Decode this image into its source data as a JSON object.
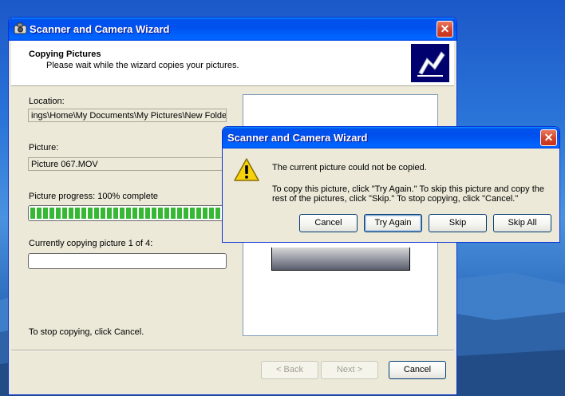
{
  "wizard": {
    "title": "Scanner and Camera Wizard",
    "header_title": "Copying Pictures",
    "header_subtitle": "Please wait while the wizard copies your pictures.",
    "location_label": "Location:",
    "location_value": "ings\\Home\\My Documents\\My Pictures\\New Folder",
    "picture_label": "Picture:",
    "picture_value": "Picture 067.MOV",
    "picture_progress_label": "Picture progress: 100% complete",
    "picture_progress_percent": 100,
    "copying_label": "Currently copying picture 1 of 4:",
    "copying_progress_percent": 0,
    "stop_hint": "To stop copying, click Cancel.",
    "back_label": "< Back",
    "next_label": "Next >",
    "cancel_label": "Cancel"
  },
  "error_dialog": {
    "title": "Scanner and Camera Wizard",
    "message": "The current picture could not be copied.",
    "instructions_line1": "To copy this picture, click \"Try Again.\" To skip this picture and copy the",
    "instructions_line2": "rest of the pictures, click \"Skip.\" To stop copying, click \"Cancel.\"",
    "buttons": {
      "cancel": "Cancel",
      "try_again": "Try Again",
      "skip": "Skip",
      "skip_all": "Skip All"
    }
  },
  "icons": {
    "title_icon": "camera-icon",
    "close": "close-icon",
    "warning": "warning-icon",
    "wizard_logo": "wizard-logo-icon"
  },
  "colors": {
    "titlebar_blue": "#0054e3",
    "progress_green": "#37b834",
    "window_face": "#ece9d8",
    "close_red": "#d3442a"
  }
}
